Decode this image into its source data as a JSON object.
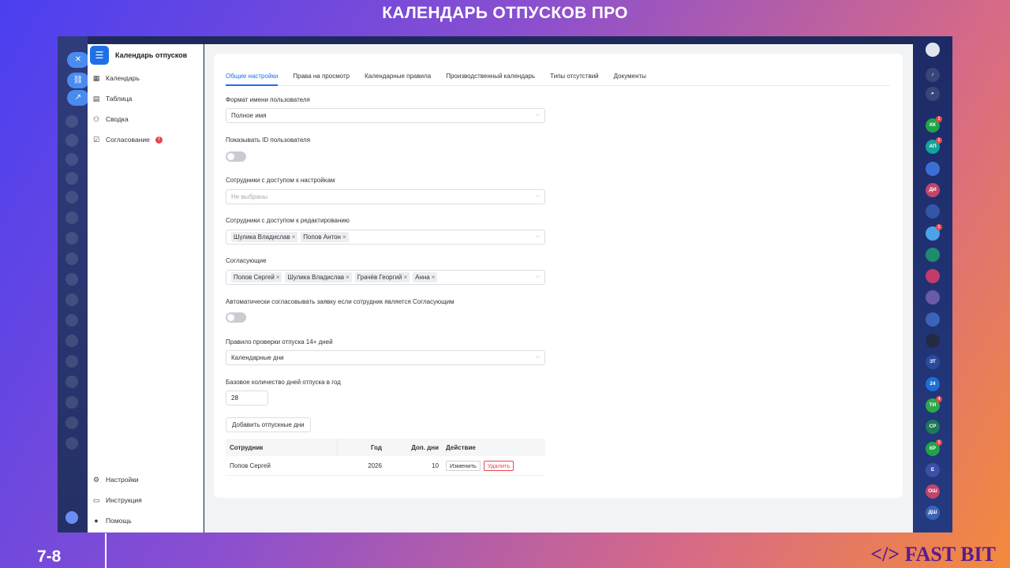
{
  "slide": {
    "title": "КАЛЕНДАРЬ ОТПУСКОВ ПРО",
    "page": "7-8",
    "brand": "</> FAST BIT"
  },
  "sidebar": {
    "title": "Календарь отпусков",
    "items": [
      {
        "label": "Календарь",
        "icon": "calendar-icon"
      },
      {
        "label": "Таблица",
        "icon": "table-icon"
      },
      {
        "label": "Сводка",
        "icon": "summary-icon"
      },
      {
        "label": "Согласование",
        "icon": "approval-icon",
        "badge": "!"
      }
    ],
    "footer": [
      {
        "label": "Настройки",
        "icon": "gear-icon"
      },
      {
        "label": "Инструкция",
        "icon": "book-icon"
      },
      {
        "label": "Помощь",
        "icon": "help-icon"
      }
    ]
  },
  "tabs": [
    "Общие настройки",
    "Права на просмотр",
    "Календарные правила",
    "Производственный календарь",
    "Типы отсутствий",
    "Документы"
  ],
  "active_tab": "Общие настройки",
  "form": {
    "name_format_label": "Формат имени пользователя",
    "name_format_value": "Полное имя",
    "show_id_label": "Показывать ID пользователя",
    "show_id_on": false,
    "settings_access_label": "Сотрудники с доступом к настройкам",
    "settings_access_placeholder": "Не выбраны",
    "edit_access_label": "Сотрудники с доступом к редактированию",
    "edit_access_chips": [
      "Шулика Владислав",
      "Попов Антон"
    ],
    "approvers_label": "Согласующие",
    "approvers_chips": [
      "Попов Сергей",
      "Шулика Владислав",
      "Грачёв Георгий",
      "Анна"
    ],
    "auto_approve_label": "Автоматически согласовывать заявку если сотрудник является Согласующим",
    "auto_approve_on": false,
    "rule_label": "Правило проверки отпуска 14+ дней",
    "rule_value": "Календарные дни",
    "base_days_label": "Базовое количество дней отпуска в год",
    "base_days_value": "28",
    "add_days_button": "Добавить отпускные дни"
  },
  "table": {
    "headers": [
      "Сотрудник",
      "Год",
      "Доп. дни",
      "Действие"
    ],
    "rows": [
      {
        "employee": "Попов Сергей",
        "year": "2026",
        "extra_days": "10",
        "edit": "Изменить",
        "delete": "Удалить"
      }
    ]
  },
  "chip_remove": "×",
  "chevron": "⌵",
  "right_rail": {
    "avatars": [
      {
        "text": "КК",
        "color": "#1fa34a",
        "badge": "1"
      },
      {
        "text": "АП",
        "color": "#12a39a",
        "badge": "1"
      },
      {
        "text": "",
        "color": "#3b6fd6"
      },
      {
        "text": "ДИ",
        "color": "#c2446a"
      },
      {
        "text": "",
        "color": "#3456a8"
      },
      {
        "text": "",
        "color": "#4da3e8",
        "badge": "1"
      },
      {
        "text": "",
        "color": "#1e8a6e"
      },
      {
        "text": "",
        "color": "#c23b6a"
      },
      {
        "text": "",
        "color": "#6a5aa8"
      },
      {
        "text": "",
        "color": "#3a64b8"
      },
      {
        "text": "",
        "color": "#222a44"
      },
      {
        "text": "ЗТ",
        "color": "#2b4a9e"
      },
      {
        "text": "24",
        "color": "#1c6fd8"
      },
      {
        "text": "ТИ",
        "color": "#2ea74a",
        "badge": "4"
      },
      {
        "text": "СР",
        "color": "#1c7a55"
      },
      {
        "text": "КР",
        "color": "#1fa34a",
        "badge": "1"
      },
      {
        "text": "Е",
        "color": "#3a50a8"
      },
      {
        "text": "ОШ",
        "color": "#c2446a"
      },
      {
        "text": "ДШ",
        "color": "#3a64b8"
      }
    ]
  }
}
